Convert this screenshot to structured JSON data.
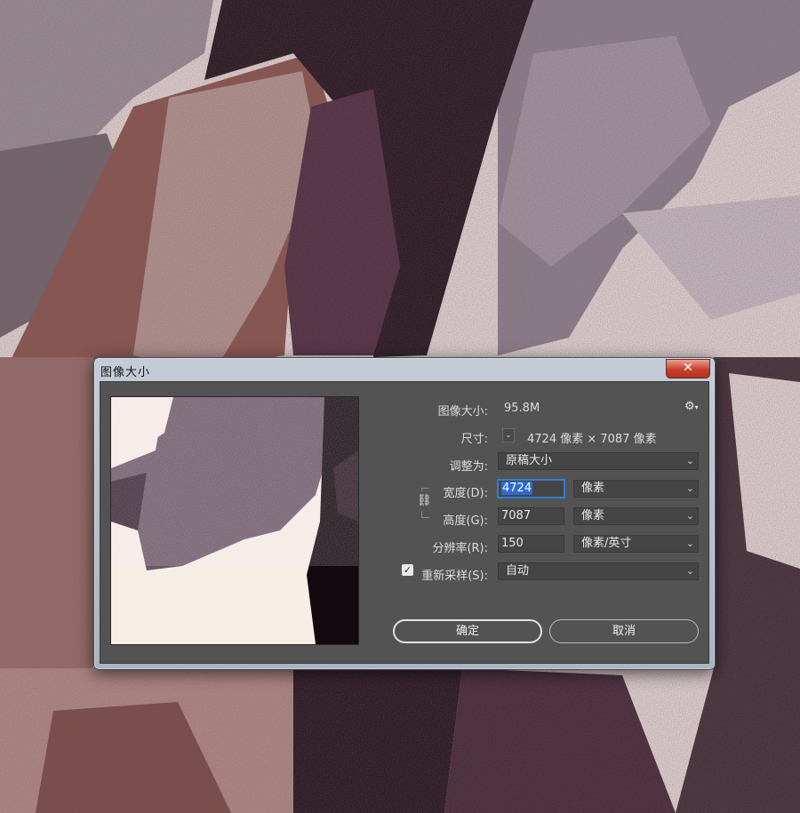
{
  "dialog": {
    "title": "图像大小",
    "close_glyph": "✕"
  },
  "info": {
    "image_size_label": "图像大小:",
    "image_size_value": "95.8M",
    "dimensions_label": "尺寸:",
    "dimensions_value": "4724 像素 × 7087 像素",
    "gear_icon": "gear-icon"
  },
  "fit_to": {
    "label": "调整为:",
    "value": "原稿大小"
  },
  "width": {
    "label": "宽度(D):",
    "value": "4724",
    "unit": "像素"
  },
  "height": {
    "label": "高度(G):",
    "value": "7087",
    "unit": "像素"
  },
  "resolution": {
    "label": "分辨率(R):",
    "value": "150",
    "unit": "像素/英寸"
  },
  "resample": {
    "label": "重新采样(S):",
    "checked": true,
    "value": "自动"
  },
  "buttons": {
    "ok": "确定",
    "cancel": "取消"
  },
  "colors": {
    "panel": "#535353",
    "field": "#454545",
    "accent_blue": "#2f7ed8",
    "close_red": "#c7402c"
  }
}
